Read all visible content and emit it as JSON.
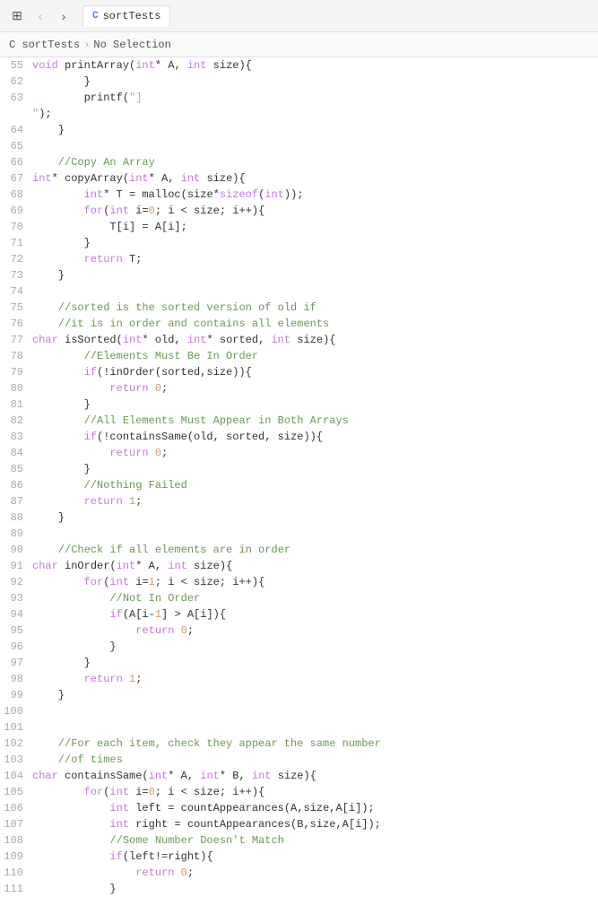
{
  "topbar": {
    "tab_c_label": "C",
    "tab_name": "sortTests",
    "nav_back_label": "‹",
    "nav_forward_label": "›",
    "grid_icon": "⊞"
  },
  "breadcrumb": {
    "item1": "C sortTests",
    "sep": "›",
    "item2": "No Selection"
  },
  "lines": [
    {
      "num": "55",
      "tokens": [
        {
          "t": "kw",
          "v": "void"
        },
        {
          "t": "var",
          "v": " printArray("
        },
        {
          "t": "kw",
          "v": "int"
        },
        {
          "t": "var",
          "v": "* A, "
        },
        {
          "t": "kw",
          "v": "int"
        },
        {
          "t": "var",
          "v": " size){"
        }
      ]
    },
    {
      "num": "62",
      "tokens": [
        {
          "t": "var",
          "v": "        }"
        }
      ]
    },
    {
      "num": "63",
      "tokens": [
        {
          "t": "var",
          "v": "        printf("
        },
        {
          "t": "str",
          "v": "\"]\n\""
        },
        {
          "t": "var",
          "v": ");"
        }
      ]
    },
    {
      "num": "64",
      "tokens": [
        {
          "t": "var",
          "v": "    }"
        }
      ]
    },
    {
      "num": "65",
      "tokens": []
    },
    {
      "num": "66",
      "tokens": [
        {
          "t": "comment",
          "v": "    //Copy An Array"
        }
      ]
    },
    {
      "num": "67",
      "tokens": [
        {
          "t": "kw",
          "v": "int"
        },
        {
          "t": "var",
          "v": "* copyArray("
        },
        {
          "t": "kw",
          "v": "int"
        },
        {
          "t": "var",
          "v": "* A, "
        },
        {
          "t": "kw",
          "v": "int"
        },
        {
          "t": "var",
          "v": " size){"
        }
      ]
    },
    {
      "num": "68",
      "tokens": [
        {
          "t": "var",
          "v": "        "
        },
        {
          "t": "kw",
          "v": "int"
        },
        {
          "t": "var",
          "v": "* T = malloc(size*"
        },
        {
          "t": "kw",
          "v": "sizeof"
        },
        {
          "t": "var",
          "v": "("
        },
        {
          "t": "kw",
          "v": "int"
        },
        {
          "t": "var",
          "v": "));"
        }
      ]
    },
    {
      "num": "69",
      "tokens": [
        {
          "t": "var",
          "v": "        "
        },
        {
          "t": "kw",
          "v": "for"
        },
        {
          "t": "var",
          "v": "("
        },
        {
          "t": "kw",
          "v": "int"
        },
        {
          "t": "var",
          "v": " i="
        },
        {
          "t": "num",
          "v": "0"
        },
        {
          "t": "var",
          "v": "; i < size; i++){"
        }
      ]
    },
    {
      "num": "70",
      "tokens": [
        {
          "t": "var",
          "v": "            T[i] = A[i];"
        }
      ]
    },
    {
      "num": "71",
      "tokens": [
        {
          "t": "var",
          "v": "        }"
        }
      ]
    },
    {
      "num": "72",
      "tokens": [
        {
          "t": "var",
          "v": "        "
        },
        {
          "t": "kw",
          "v": "return"
        },
        {
          "t": "var",
          "v": " T;"
        }
      ]
    },
    {
      "num": "73",
      "tokens": [
        {
          "t": "var",
          "v": "    }"
        }
      ]
    },
    {
      "num": "74",
      "tokens": []
    },
    {
      "num": "75",
      "tokens": [
        {
          "t": "comment",
          "v": "    //sorted is the sorted version of old if"
        }
      ]
    },
    {
      "num": "76",
      "tokens": [
        {
          "t": "comment",
          "v": "    //it is in order and contains all elements"
        }
      ]
    },
    {
      "num": "77",
      "tokens": [
        {
          "t": "kw",
          "v": "char"
        },
        {
          "t": "var",
          "v": " isSorted("
        },
        {
          "t": "kw",
          "v": "int"
        },
        {
          "t": "var",
          "v": "* old, "
        },
        {
          "t": "kw",
          "v": "int"
        },
        {
          "t": "var",
          "v": "* sorted, "
        },
        {
          "t": "kw",
          "v": "int"
        },
        {
          "t": "var",
          "v": " size){"
        }
      ]
    },
    {
      "num": "78",
      "tokens": [
        {
          "t": "comment",
          "v": "        //Elements Must Be In Order"
        }
      ]
    },
    {
      "num": "79",
      "tokens": [
        {
          "t": "var",
          "v": "        "
        },
        {
          "t": "kw",
          "v": "if"
        },
        {
          "t": "var",
          "v": "(!inOrder(sorted,size)){"
        }
      ]
    },
    {
      "num": "80",
      "tokens": [
        {
          "t": "var",
          "v": "            "
        },
        {
          "t": "kw",
          "v": "return"
        },
        {
          "t": "var",
          "v": " "
        },
        {
          "t": "num",
          "v": "0"
        },
        {
          "t": "var",
          "v": ";"
        }
      ]
    },
    {
      "num": "81",
      "tokens": [
        {
          "t": "var",
          "v": "        }"
        }
      ]
    },
    {
      "num": "82",
      "tokens": [
        {
          "t": "comment",
          "v": "        //All Elements Must Appear in Both Arrays"
        }
      ]
    },
    {
      "num": "83",
      "tokens": [
        {
          "t": "var",
          "v": "        "
        },
        {
          "t": "kw",
          "v": "if"
        },
        {
          "t": "var",
          "v": "(!containsSame(old, sorted, size)){"
        }
      ]
    },
    {
      "num": "84",
      "tokens": [
        {
          "t": "var",
          "v": "            "
        },
        {
          "t": "kw",
          "v": "return"
        },
        {
          "t": "var",
          "v": " "
        },
        {
          "t": "num",
          "v": "0"
        },
        {
          "t": "var",
          "v": ";"
        }
      ]
    },
    {
      "num": "85",
      "tokens": [
        {
          "t": "var",
          "v": "        }"
        }
      ]
    },
    {
      "num": "86",
      "tokens": [
        {
          "t": "comment",
          "v": "        //Nothing Failed"
        }
      ]
    },
    {
      "num": "87",
      "tokens": [
        {
          "t": "var",
          "v": "        "
        },
        {
          "t": "kw",
          "v": "return"
        },
        {
          "t": "var",
          "v": " "
        },
        {
          "t": "num",
          "v": "1"
        },
        {
          "t": "var",
          "v": ";"
        }
      ]
    },
    {
      "num": "88",
      "tokens": [
        {
          "t": "var",
          "v": "    }"
        }
      ]
    },
    {
      "num": "89",
      "tokens": []
    },
    {
      "num": "90",
      "tokens": [
        {
          "t": "comment",
          "v": "    //Check if all elements are in order"
        }
      ]
    },
    {
      "num": "91",
      "tokens": [
        {
          "t": "kw",
          "v": "char"
        },
        {
          "t": "var",
          "v": " inOrder("
        },
        {
          "t": "kw",
          "v": "int"
        },
        {
          "t": "var",
          "v": "* A, "
        },
        {
          "t": "kw",
          "v": "int"
        },
        {
          "t": "var",
          "v": " size){"
        }
      ]
    },
    {
      "num": "92",
      "tokens": [
        {
          "t": "var",
          "v": "        "
        },
        {
          "t": "kw",
          "v": "for"
        },
        {
          "t": "var",
          "v": "("
        },
        {
          "t": "kw",
          "v": "int"
        },
        {
          "t": "var",
          "v": " i="
        },
        {
          "t": "num",
          "v": "1"
        },
        {
          "t": "var",
          "v": "; i < size; i++){"
        }
      ]
    },
    {
      "num": "93",
      "tokens": [
        {
          "t": "comment",
          "v": "            //Not In Order"
        }
      ]
    },
    {
      "num": "94",
      "tokens": [
        {
          "t": "var",
          "v": "            "
        },
        {
          "t": "kw",
          "v": "if"
        },
        {
          "t": "var",
          "v": "(A[i-"
        },
        {
          "t": "num",
          "v": "1"
        },
        {
          "t": "var",
          "v": "] > A[i]){"
        }
      ]
    },
    {
      "num": "95",
      "tokens": [
        {
          "t": "var",
          "v": "                "
        },
        {
          "t": "kw",
          "v": "return"
        },
        {
          "t": "var",
          "v": " "
        },
        {
          "t": "num",
          "v": "0"
        },
        {
          "t": "var",
          "v": ";"
        }
      ]
    },
    {
      "num": "96",
      "tokens": [
        {
          "t": "var",
          "v": "            }"
        }
      ]
    },
    {
      "num": "97",
      "tokens": [
        {
          "t": "var",
          "v": "        }"
        }
      ]
    },
    {
      "num": "98",
      "tokens": [
        {
          "t": "var",
          "v": "        "
        },
        {
          "t": "kw",
          "v": "return"
        },
        {
          "t": "var",
          "v": " "
        },
        {
          "t": "num",
          "v": "1"
        },
        {
          "t": "var",
          "v": ";"
        }
      ]
    },
    {
      "num": "99",
      "tokens": [
        {
          "t": "var",
          "v": "    }"
        }
      ]
    },
    {
      "num": "100",
      "tokens": []
    },
    {
      "num": "101",
      "tokens": []
    },
    {
      "num": "102",
      "tokens": [
        {
          "t": "comment",
          "v": "    //For each item, check they appear the same number"
        }
      ]
    },
    {
      "num": "103",
      "tokens": [
        {
          "t": "comment",
          "v": "    //of times"
        }
      ]
    },
    {
      "num": "104",
      "tokens": [
        {
          "t": "kw",
          "v": "char"
        },
        {
          "t": "var",
          "v": " containsSame("
        },
        {
          "t": "kw",
          "v": "int"
        },
        {
          "t": "var",
          "v": "* A, "
        },
        {
          "t": "kw",
          "v": "int"
        },
        {
          "t": "var",
          "v": "* B, "
        },
        {
          "t": "kw",
          "v": "int"
        },
        {
          "t": "var",
          "v": " size){"
        }
      ]
    },
    {
      "num": "105",
      "tokens": [
        {
          "t": "var",
          "v": "        "
        },
        {
          "t": "kw",
          "v": "for"
        },
        {
          "t": "var",
          "v": "("
        },
        {
          "t": "kw",
          "v": "int"
        },
        {
          "t": "var",
          "v": " i="
        },
        {
          "t": "num",
          "v": "0"
        },
        {
          "t": "var",
          "v": "; i < size; i++){"
        }
      ]
    },
    {
      "num": "106",
      "tokens": [
        {
          "t": "var",
          "v": "            "
        },
        {
          "t": "kw",
          "v": "int"
        },
        {
          "t": "var",
          "v": " left = countAppearances(A,size,A[i]);"
        }
      ]
    },
    {
      "num": "107",
      "tokens": [
        {
          "t": "var",
          "v": "            "
        },
        {
          "t": "kw",
          "v": "int"
        },
        {
          "t": "var",
          "v": " right = countAppearances(B,size,A[i]);"
        }
      ]
    },
    {
      "num": "108",
      "tokens": [
        {
          "t": "comment",
          "v": "            //Some Number Doesn't Match"
        }
      ]
    },
    {
      "num": "109",
      "tokens": [
        {
          "t": "var",
          "v": "            "
        },
        {
          "t": "kw",
          "v": "if"
        },
        {
          "t": "var",
          "v": "(left!=right){"
        }
      ]
    },
    {
      "num": "110",
      "tokens": [
        {
          "t": "var",
          "v": "                "
        },
        {
          "t": "kw",
          "v": "return"
        },
        {
          "t": "var",
          "v": " "
        },
        {
          "t": "num",
          "v": "0"
        },
        {
          "t": "var",
          "v": ";"
        }
      ]
    },
    {
      "num": "111",
      "tokens": [
        {
          "t": "var",
          "v": "            }"
        }
      ]
    }
  ]
}
